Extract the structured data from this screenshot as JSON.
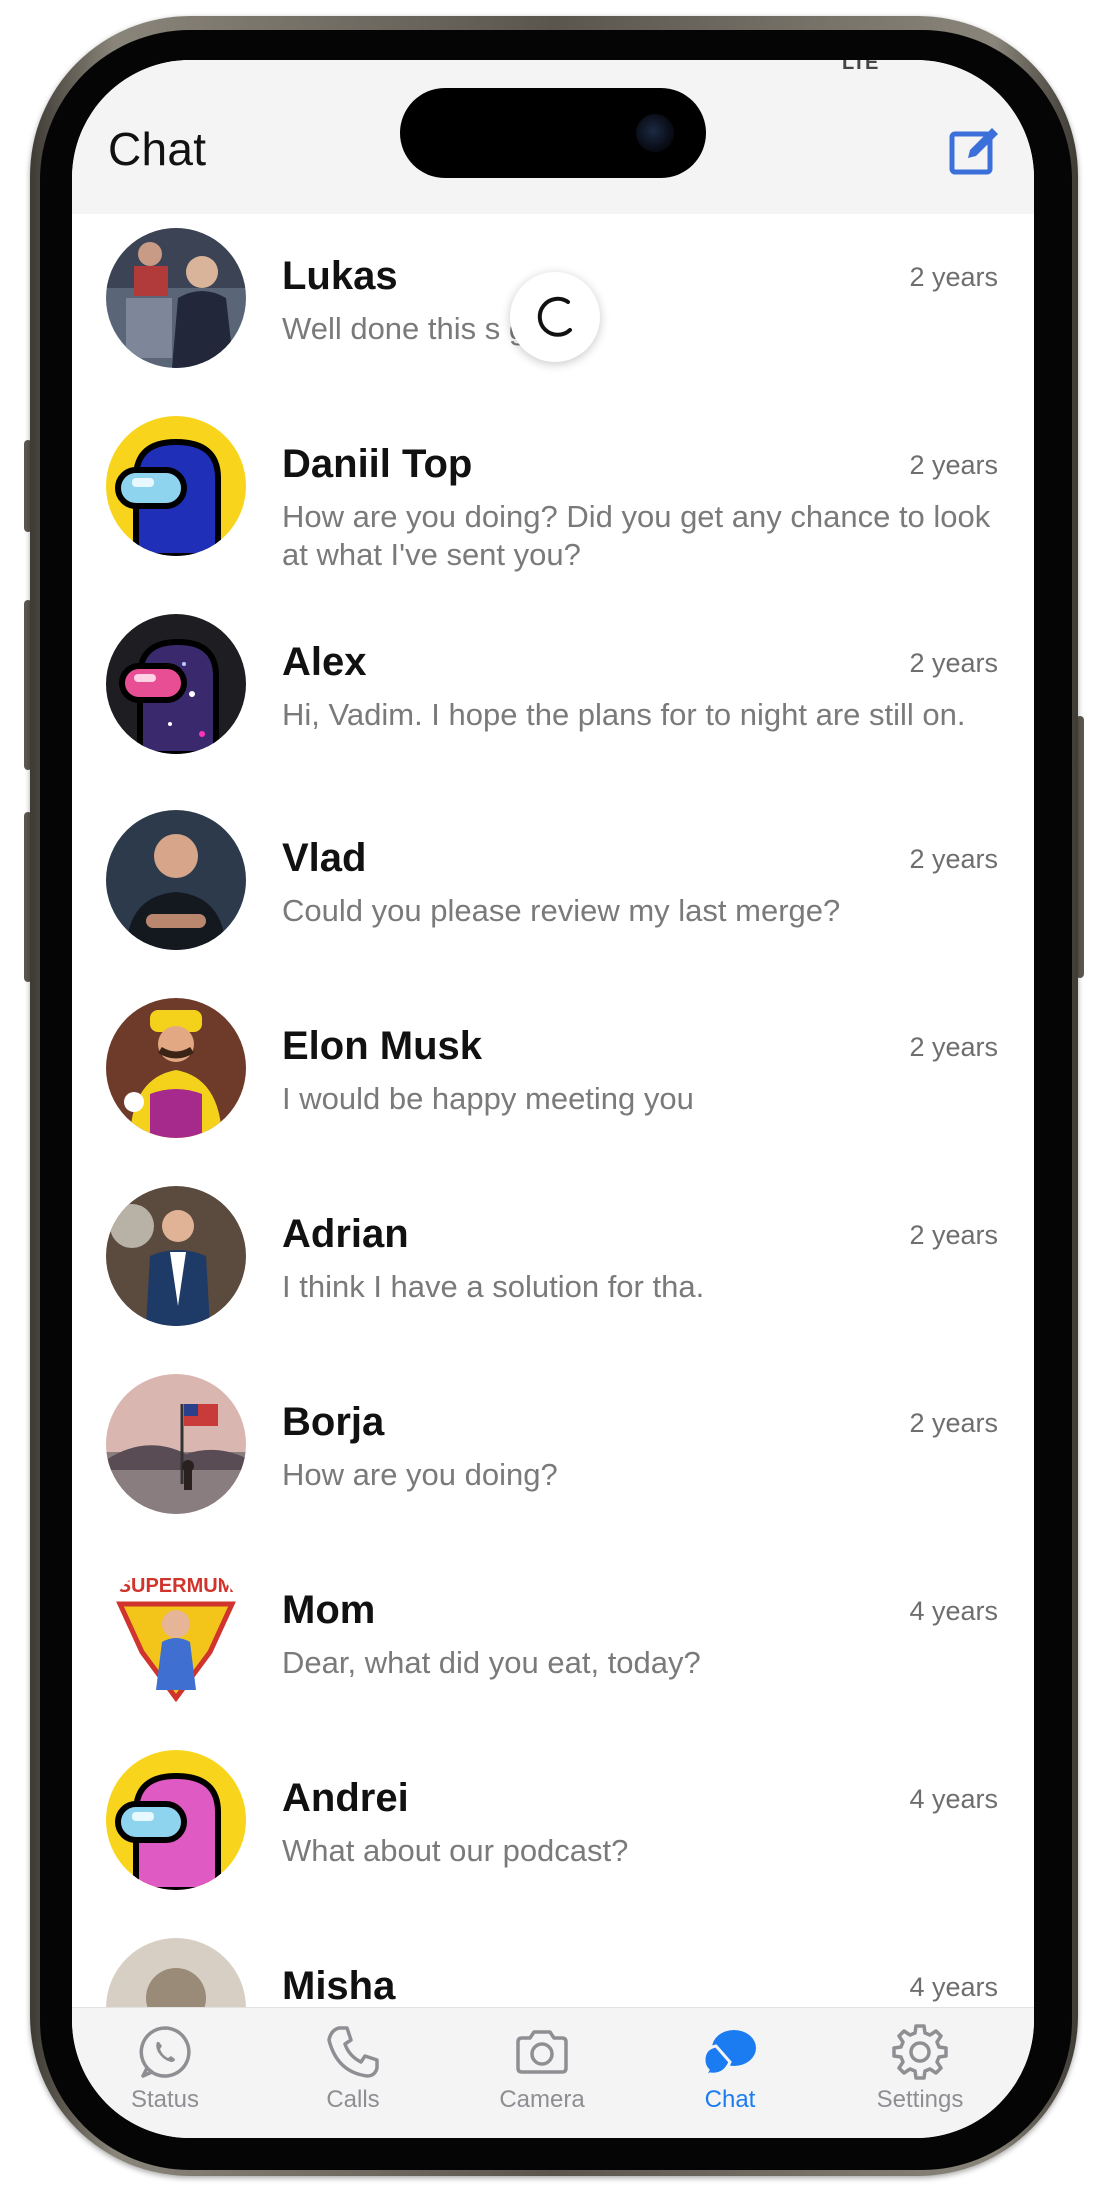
{
  "header": {
    "title": "Chat",
    "status_fragment": "LTE"
  },
  "chats": [
    {
      "name": "Lukas",
      "time": "2 years",
      "message": "Well done this s guys!"
    },
    {
      "name": "Daniil Top",
      "time": "2 years",
      "message": "How are you doing? Did you get any chance to look at what I've sent you?"
    },
    {
      "name": "Alex",
      "time": "2 years",
      "message": "Hi, Vadim. I hope the plans for to night are still on."
    },
    {
      "name": "Vlad",
      "time": "2 years",
      "message": "Could you please review my last merge?"
    },
    {
      "name": "Elon Musk",
      "time": "2 years",
      "message": "I would be happy meeting you"
    },
    {
      "name": "Adrian",
      "time": "2 years",
      "message": "I think I have a solution for tha."
    },
    {
      "name": "Borja",
      "time": "2 years",
      "message": "How are you doing?"
    },
    {
      "name": "Mom",
      "time": "4 years",
      "message": "Dear, what did you eat, today?",
      "avatar_text": "SUPERMUM"
    },
    {
      "name": "Andrei",
      "time": "4 years",
      "message": "What about our podcast?"
    },
    {
      "name": "Misha",
      "time": "4 years",
      "message": ""
    }
  ],
  "tabs": [
    {
      "label": "Status",
      "icon": "whatsapp-icon",
      "active": false
    },
    {
      "label": "Calls",
      "icon": "phone-icon",
      "active": false
    },
    {
      "label": "Camera",
      "icon": "camera-icon",
      "active": false
    },
    {
      "label": "Chat",
      "icon": "chat-bubble-icon",
      "active": true
    },
    {
      "label": "Settings",
      "icon": "gear-icon",
      "active": false
    }
  ],
  "colors": {
    "accent": "#1b7cf2",
    "header_bg": "#f4f4f5",
    "secondary_text": "#7a7a7a"
  }
}
